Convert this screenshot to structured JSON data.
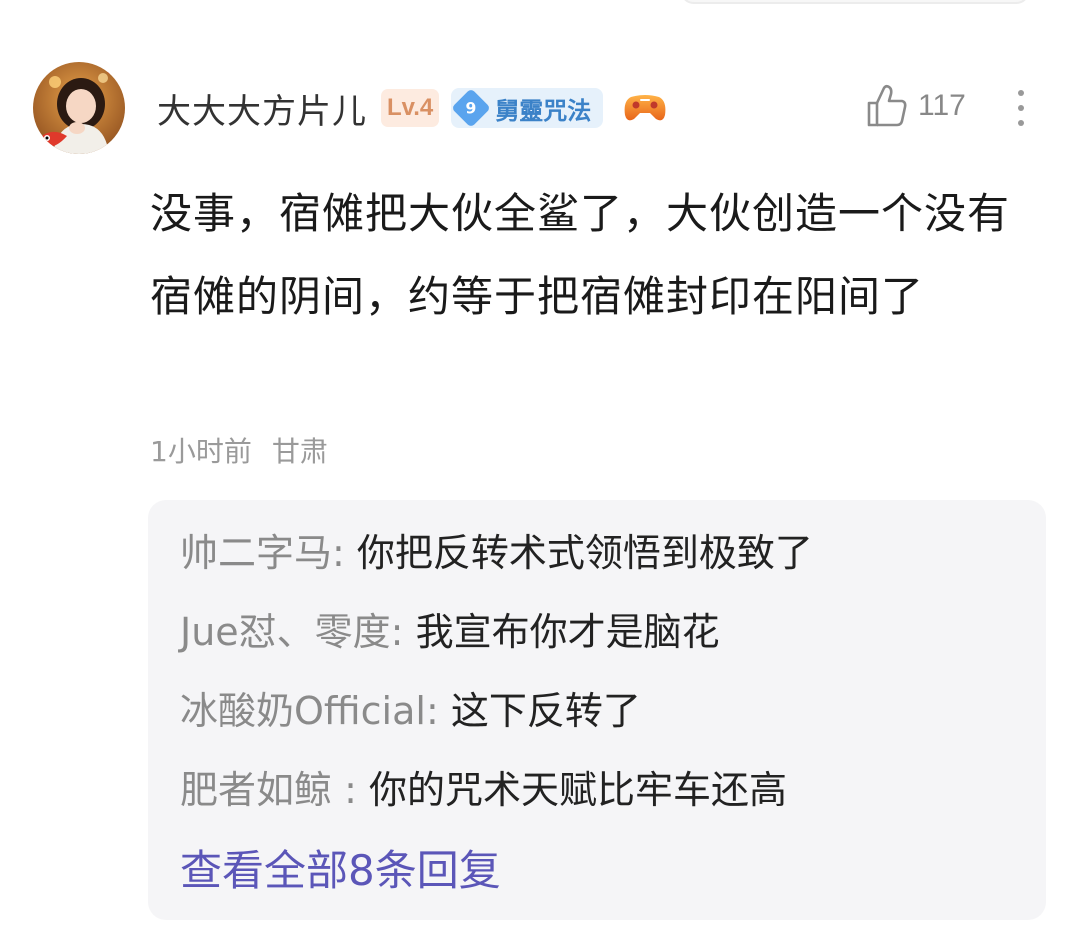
{
  "comment": {
    "username": "大大大方片儿",
    "level": "Lv.4",
    "fan_badge": {
      "number": "9",
      "name": "舅靈咒法"
    },
    "like_count": "117",
    "content": "没事，宿傩把大伙全鲨了，大伙创造一个没有宿傩的阴间，约等于把宿傩封印在阳间了",
    "time": "1小时前",
    "location": "甘肃"
  },
  "replies": [
    {
      "author": "帅二字马:",
      "text": " 你把反转术式领悟到极致了"
    },
    {
      "author": "Jue怼、零度:",
      "text": " 我宣布你才是脑花"
    },
    {
      "author": "冰酸奶Official:",
      "text": " 这下反转了"
    },
    {
      "author": "肥者如鲸 :",
      "text": " 你的咒术天赋比牢车还高"
    }
  ],
  "view_all_label": "查看全部8条回复",
  "icons": {
    "like": "thumbs-up-icon",
    "more": "more-vertical-icon",
    "game": "gamepad-icon",
    "fan_badge": "diamond-badge-icon"
  },
  "colors": {
    "level_bg": "#fdebe0",
    "level_text": "#d99063",
    "badge_bg": "#e6f1fb",
    "badge_text": "#3b82c8",
    "link": "#5b56b8",
    "reply_bg": "#f5f5f7"
  }
}
